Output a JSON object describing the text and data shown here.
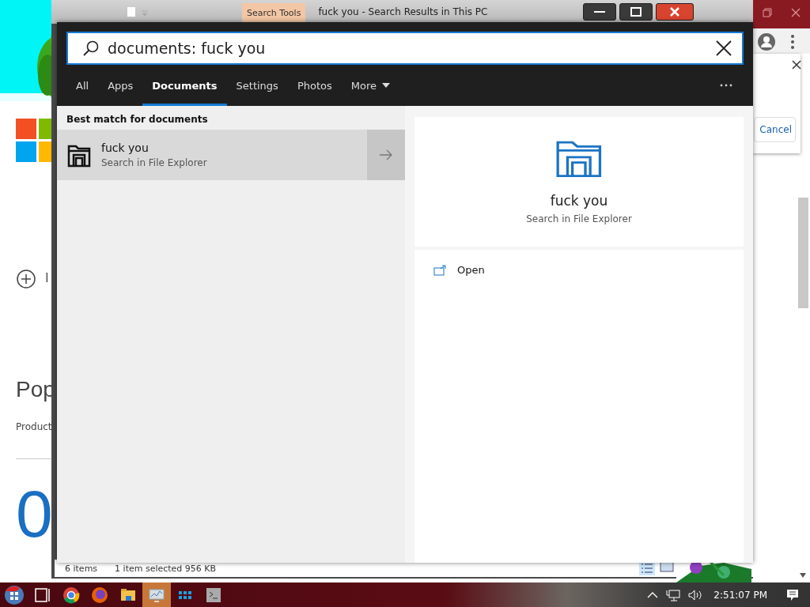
{
  "background_page": {
    "link_text": "I",
    "heading": "Pop",
    "subheading": "Product",
    "big_number": "0"
  },
  "explorer_window": {
    "ribbon_tab": "Search Tools",
    "title": "fuck you - Search Results in This PC",
    "status_bar": {
      "item_count": "6 items",
      "selection": "1 item selected  956 KB"
    }
  },
  "browser_window": {
    "dialog_button": "Cancel"
  },
  "search_panel": {
    "query": "documents: fuck you",
    "tabs": [
      {
        "label": "All",
        "selected": false,
        "kind": "plain"
      },
      {
        "label": "Apps",
        "selected": false,
        "kind": "plain"
      },
      {
        "label": "Documents",
        "selected": true,
        "kind": "plain"
      },
      {
        "label": "Settings",
        "selected": false,
        "kind": "plain"
      },
      {
        "label": "Photos",
        "selected": false,
        "kind": "plain"
      },
      {
        "label": "More",
        "selected": false,
        "kind": "dropdown"
      }
    ],
    "section_title": "Best match for documents",
    "results": [
      {
        "title": "fuck you",
        "subtitle": "Search in File Explorer",
        "selected": true
      }
    ],
    "preview": {
      "title": "fuck you",
      "subtitle": "Search in File Explorer",
      "actions": [
        {
          "label": "Open"
        }
      ]
    }
  },
  "taskbar": {
    "clock": "2:51:07 PM"
  }
}
